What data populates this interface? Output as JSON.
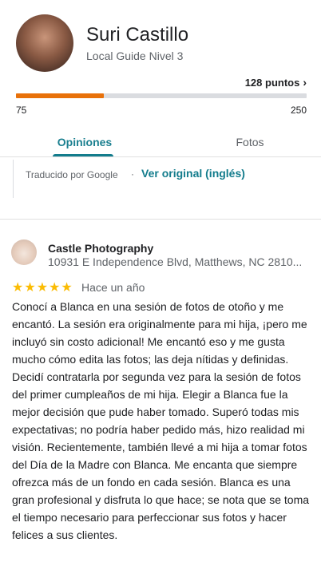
{
  "profile": {
    "name": "Suri Castillo",
    "level": "Local Guide Nivel 3",
    "points": "128 puntos",
    "progress_min": "75",
    "progress_max": "250",
    "progress_value": 128
  },
  "tabs": {
    "reviews": "Opiniones",
    "photos": "Fotos"
  },
  "translation": {
    "by": "Traducido por Google",
    "separator": "·",
    "original": "Ver original (inglés)"
  },
  "review": {
    "place_name": "Castle Photography",
    "address": "10931 E Independence Blvd, Matthews, NC 2810...",
    "stars": "★★★★★",
    "rating": 5,
    "date": "Hace un año",
    "text": "Conocí a Blanca en una sesión de fotos de otoño y me encantó. La sesión era originalmente para mi hija, ¡pero me incluyó sin costo adicional! Me encantó eso y me gusta mucho cómo edita las fotos; las deja nítidas y definidas. Decidí contratarla por segunda vez para la sesión de fotos del primer cumpleaños de mi hija. Elegir a Blanca fue la mejor decisión que pude haber tomado. Superó todas mis expectativas; no podría haber pedido más, hizo realidad mi visión. Recientemente, también llevé a mi hija a tomar fotos del Día de la Madre con Blanca. Me encanta que siempre ofrezca más de un fondo en cada sesión. Blanca es una gran profesional y disfruta lo que hace; se nota que se toma el tiempo necesario para perfeccionar sus fotos y hacer felices a sus clientes."
  },
  "colors": {
    "accent": "#137c8c",
    "progress": "#e8710a",
    "star": "#fbbc04"
  }
}
